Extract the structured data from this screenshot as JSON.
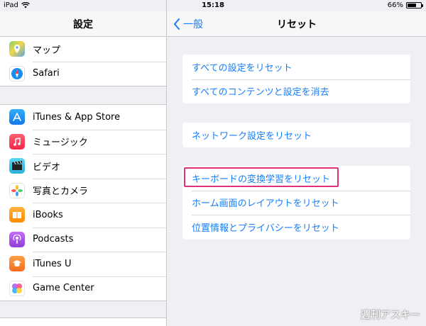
{
  "status": {
    "device": "iPad",
    "time": "15:18",
    "battery": "66%",
    "battery_level": 0.66
  },
  "left": {
    "title": "設定",
    "group1": [
      {
        "label": "マップ",
        "icon": "maps-icon",
        "color": "#6ac26d"
      },
      {
        "label": "Safari",
        "icon": "safari-icon",
        "color": "#1a8cf0"
      }
    ],
    "group2": [
      {
        "label": "iTunes & App Store",
        "icon": "app-store-icon",
        "color": "#1b8df3"
      },
      {
        "label": "ミュージック",
        "icon": "music-icon",
        "color": "#fa3b55"
      },
      {
        "label": "ビデオ",
        "icon": "video-icon",
        "color": "#3fc4e8"
      },
      {
        "label": "写真とカメラ",
        "icon": "photos-icon",
        "color": "#f9a826"
      },
      {
        "label": "iBooks",
        "icon": "ibooks-icon",
        "color": "#ff9500"
      },
      {
        "label": "Podcasts",
        "icon": "podcasts-icon",
        "color": "#9b51e0"
      },
      {
        "label": "iTunes U",
        "icon": "itunes-u-icon",
        "color": "#f58220"
      },
      {
        "label": "Game Center",
        "icon": "game-center-icon",
        "color": "#ffffff"
      }
    ]
  },
  "right": {
    "back_label": "一般",
    "title": "リセット",
    "group1": [
      "すべての設定をリセット",
      "すべてのコンテンツと設定を消去"
    ],
    "group2": [
      "ネットワーク設定をリセット"
    ],
    "group3": [
      "キーボードの変換学習をリセット",
      "ホーム画面のレイアウトをリセット",
      "位置情報とプライバシーをリセット"
    ]
  },
  "watermark": "週刊アスキー"
}
